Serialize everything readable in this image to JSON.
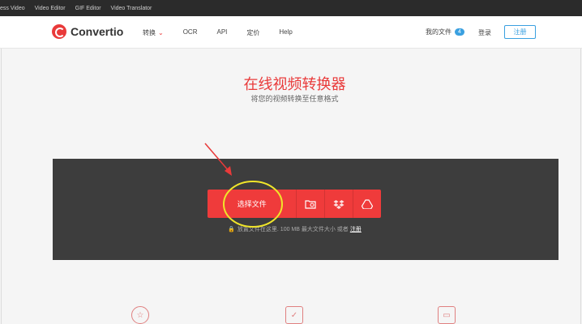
{
  "topstrip": {
    "items": [
      "ess Video",
      "Video Editor",
      "GIF Editor",
      "Video Translator"
    ]
  },
  "header": {
    "logo": "Convertio",
    "nav": {
      "convert": "转换",
      "ocr": "OCR",
      "api": "API",
      "pricing": "定价",
      "help": "Help"
    },
    "my_files": "我的文件",
    "file_count": "4",
    "login": "登录",
    "register": "注册"
  },
  "hero": {
    "title": "在线视频转换器",
    "subtitle": "将您的视频转换至任意格式"
  },
  "upload": {
    "choose_files": "选择文件",
    "hint": "放置文件在这里. 100 MB 最大文件大小 或者",
    "hint_link": "注册"
  },
  "colors": {
    "accent": "#ef3b3b",
    "dark": "#3d3d3d",
    "link": "#3aa0e0"
  },
  "icons": [
    "folder-search-icon",
    "dropbox-icon",
    "google-drive-icon",
    "star-icon",
    "clipboard-check-icon",
    "devices-icon"
  ]
}
